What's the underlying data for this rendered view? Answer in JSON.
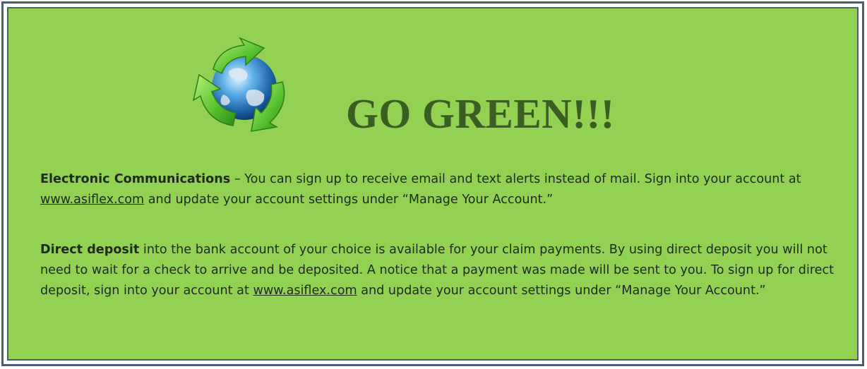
{
  "headline": "GO GREEN!!!",
  "logo": {
    "icon": "recycle-globe-icon"
  },
  "paragraphs": {
    "electronic": {
      "title": "Electronic Communications",
      "text1": " – You can sign up to receive email and text alerts instead of mail.  Sign into your account at ",
      "link": "www.asiflex.com",
      "text2": " and update your account settings under “Manage Your Account.”"
    },
    "deposit": {
      "title": "Direct deposit",
      "text1": " into the bank account of your choice is available for your claim payments. By using direct deposit you will not need to wait for a check to arrive and be deposited. A notice that a payment was made will be sent to you. To sign up for direct deposit, sign into your account at ",
      "link": "www.asiflex.com",
      "text2": " and update your account settings under “Manage Your Account.”"
    }
  },
  "colors": {
    "background": "#93d152",
    "border": "#4a5d72",
    "headline": "#3a5e22"
  }
}
